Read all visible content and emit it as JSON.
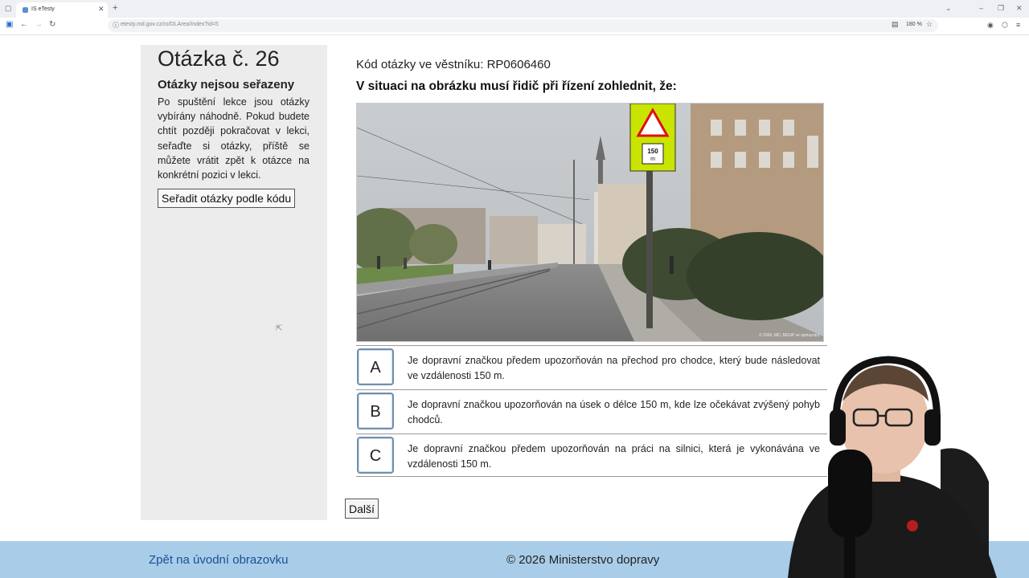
{
  "browser": {
    "tab_title": "IS eTesty",
    "url": "etesty.md.gov.cz/ro/DLArea/Index?id=5",
    "zoom": "180 %"
  },
  "sidebar": {
    "question_number": "Otázka č. 26",
    "notice_title": "Otázky nejsou seřazeny",
    "notice_text": "Po spuštění lekce jsou otázky vybírány náhodně. Pokud budete chtít později pokračovat v lekci, seřaďte si otázky, příště se můžete vrátit zpět k otázce na konkrétní pozici v lekci.",
    "sort_button": "Seřadit otázky podle kódu"
  },
  "main": {
    "question_code": "Kód otázky ve věstníku: RP0606460",
    "question_text": "V situaci na obrázku musí řidič při řízení zohlednit, že:",
    "sign_label": "150 m",
    "photo_credit": "© 2006, MD, BESIP ve spolupráci",
    "answers": [
      {
        "letter": "A",
        "text": "Je dopravní značkou předem upozorňován na přechod pro chodce, který bude následovat ve vzdálenosti 150 m."
      },
      {
        "letter": "B",
        "text": "Je dopravní značkou upozorňován na úsek o délce 150 m, kde lze očekávat zvýšený pohyb chodců."
      },
      {
        "letter": "C",
        "text": "Je dopravní značkou předem upozorňován na práci na silnici, která je vykonávána ve vzdálenosti 150 m."
      }
    ],
    "next_button": "Další"
  },
  "footer": {
    "home_link": "Zpět na úvodní obrazovku",
    "copyright": "© 2026 Ministerstvo dopravy"
  },
  "colors": {
    "footer_bg": "#a9cde8",
    "answer_border": "#6f8fb0",
    "sidebar_bg": "#ececec"
  }
}
